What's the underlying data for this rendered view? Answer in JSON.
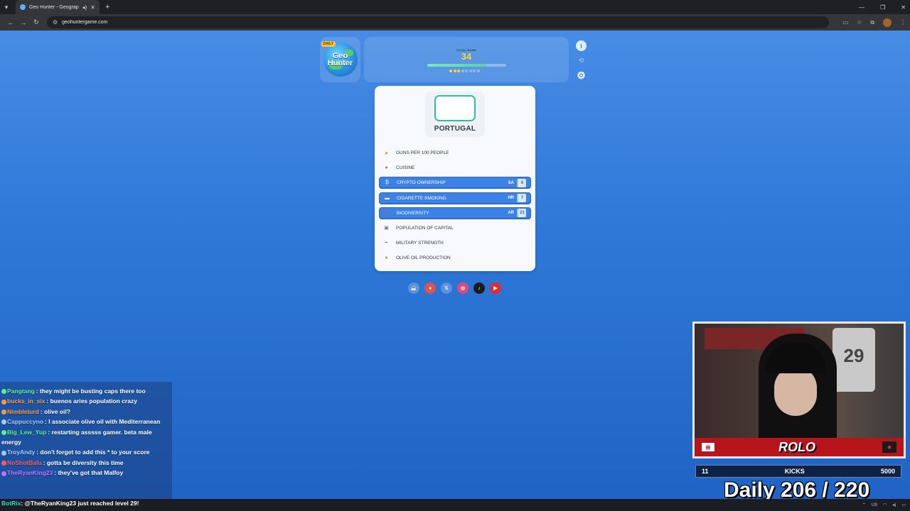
{
  "browser": {
    "tab_title": "Geo Hunter - Geography G",
    "url": "geohuntergame.com"
  },
  "logo": {
    "badge": "DAILY",
    "line1": "Geo",
    "line2": "Hunter"
  },
  "score": {
    "label": "TOTAL RANK",
    "value": "34",
    "progress_fraction": 0.75,
    "rounds_total": 8,
    "rounds_done": 3
  },
  "country": {
    "name": "PORTUGAL"
  },
  "categories": [
    {
      "label": "GUNS PER 100 PEOPLE",
      "icon": "gun-icon",
      "chosen": false,
      "code": "",
      "rank": ""
    },
    {
      "label": "CUISINE",
      "icon": "cuisine-icon",
      "chosen": false,
      "code": "",
      "rank": ""
    },
    {
      "label": "CRYPTO OWNERSHIP",
      "icon": "bitcoin-icon",
      "chosen": true,
      "code": "SA",
      "rank": "6"
    },
    {
      "label": "CIGARETTE SMOKING",
      "icon": "cigarette-icon",
      "chosen": true,
      "code": "HR",
      "rank": "7"
    },
    {
      "label": "BIODIVERSITY",
      "icon": "leaf-icon",
      "chosen": true,
      "code": "AR",
      "rank": "21"
    },
    {
      "label": "POPULATION OF CAPITAL",
      "icon": "building-icon",
      "chosen": false,
      "code": "",
      "rank": ""
    },
    {
      "label": "MILITARY STRENGTH",
      "icon": "helmet-icon",
      "chosen": false,
      "code": "",
      "rank": ""
    },
    {
      "label": "OLIVE OIL PRODUCTION",
      "icon": "olive-icon",
      "chosen": false,
      "code": "",
      "rank": ""
    }
  ],
  "chat": [
    {
      "name": "Pangtang",
      "color": "#5cf08a",
      "text": ": they might be busting caps there too"
    },
    {
      "name": "bucks_in_six",
      "color": "#ff9a3c",
      "text": ": buenos aries population crazy"
    },
    {
      "name": "Nimbleturd",
      "color": "#ff9a3c",
      "text": ": olive oil?"
    },
    {
      "name": "Cappuccyno",
      "color": "#a8c8ff",
      "text": ": I associate olive oil with Mediterranean"
    },
    {
      "name": "Big_Lew_Yup",
      "color": "#5cf08a",
      "text": ": restarting asssss gamer. beta male energy"
    },
    {
      "name": "TroyAndy",
      "color": "#a8c8ff",
      "text": ": don't forget to add this * to your score"
    },
    {
      "name": "NoShotBalu",
      "color": "#ff5a5a",
      "text": ": gotta be diversity this time"
    },
    {
      "name": "TheRyanKing23",
      "color": "#c86cff",
      "text": ": they've got that Malfoy"
    }
  ],
  "botrix": {
    "name": "BotRix",
    "text": ": @TheRyanKing23 just reached level 29!"
  },
  "stream": {
    "jersey_number": "29",
    "brand": "ROLO",
    "kicks_left": "11",
    "kicks_label": "KICKS",
    "kicks_right": "5000",
    "daily_text": "Daily  206 / 220"
  },
  "taskbar": {
    "locale": "US"
  }
}
